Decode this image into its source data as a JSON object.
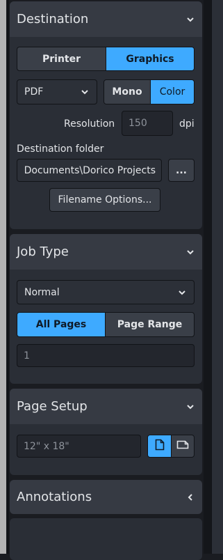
{
  "destination": {
    "title": "Destination",
    "printer_label": "Printer",
    "graphics_label": "Graphics",
    "format_value": "PDF",
    "mono_label": "Mono",
    "color_label": "Color",
    "resolution_label": "Resolution",
    "resolution_value": "150",
    "resolution_unit": "dpi",
    "folder_label": "Destination folder",
    "folder_value": "Documents\\Dorico Projects",
    "browse_label": "...",
    "filename_options_label": "Filename Options..."
  },
  "job_type": {
    "title": "Job Type",
    "type_value": "Normal",
    "all_pages_label": "All Pages",
    "page_range_label": "Page Range",
    "range_value": "1"
  },
  "page_setup": {
    "title": "Page Setup",
    "size_value": "12\" x 18\""
  },
  "annotations": {
    "title": "Annotations"
  },
  "colors": {
    "accent": "#3eaaff",
    "panel": "#2a2e36",
    "header": "#363a43"
  }
}
